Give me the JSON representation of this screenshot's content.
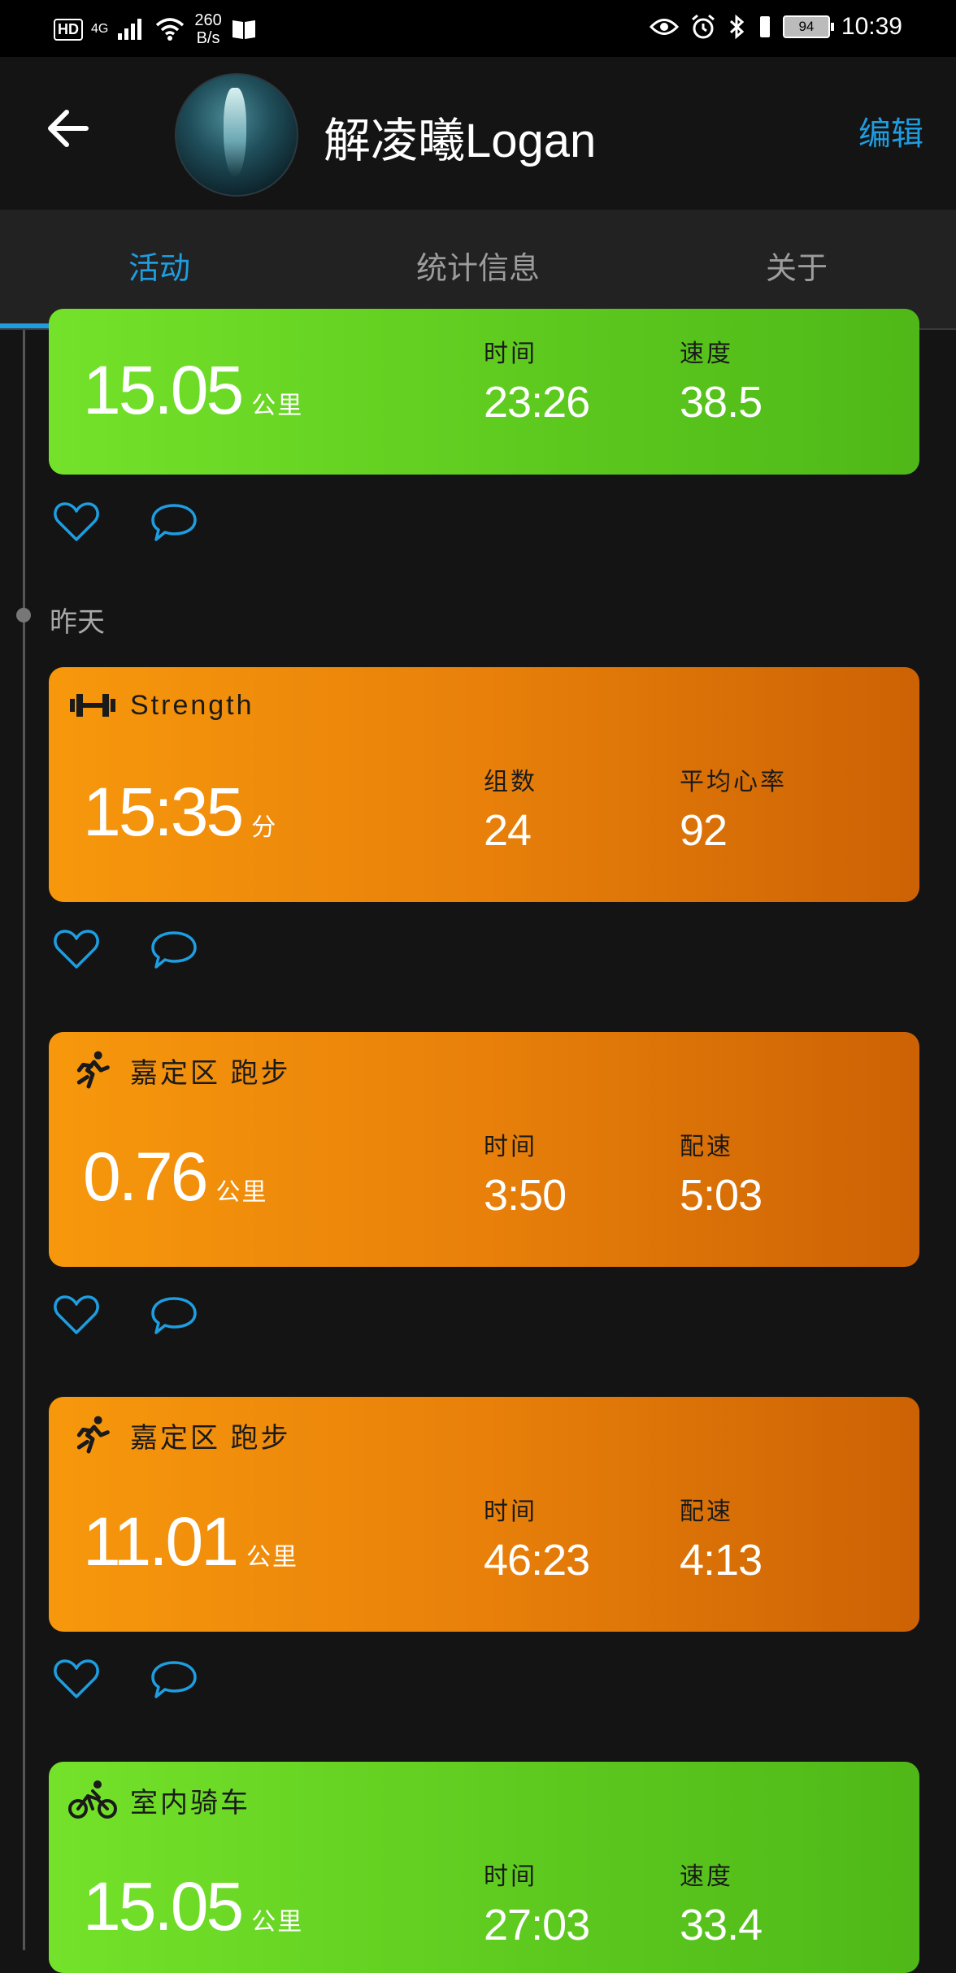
{
  "status_bar": {
    "hd": "HD",
    "network": "4G",
    "speed_value": "260",
    "speed_unit": "B/s",
    "battery": "94",
    "time": "10:39"
  },
  "header": {
    "name": "解凌曦Logan",
    "edit_label": "编辑"
  },
  "tabs": [
    {
      "label": "活动",
      "active": true
    },
    {
      "label": "统计信息",
      "active": false
    },
    {
      "label": "关于",
      "active": false
    }
  ],
  "day_label": "昨天",
  "cards": [
    {
      "color": "green",
      "title": "",
      "value": "15.05",
      "unit": "公里",
      "stat1_label": "时间",
      "stat1_value": "23:26",
      "stat2_label": "速度",
      "stat2_value": "38.5"
    },
    {
      "color": "orange",
      "title": "Strength",
      "icon": "dumbbell-icon",
      "value": "15:35",
      "unit": "分",
      "stat1_label": "组数",
      "stat1_value": "24",
      "stat2_label": "平均心率",
      "stat2_value": "92"
    },
    {
      "color": "orange",
      "title": "嘉定区 跑步",
      "icon": "running-icon",
      "value": "0.76",
      "unit": "公里",
      "stat1_label": "时间",
      "stat1_value": "3:50",
      "stat2_label": "配速",
      "stat2_value": "5:03"
    },
    {
      "color": "orange",
      "title": "嘉定区 跑步",
      "icon": "running-icon",
      "value": "11.01",
      "unit": "公里",
      "stat1_label": "时间",
      "stat1_value": "46:23",
      "stat2_label": "配速",
      "stat2_value": "4:13"
    },
    {
      "color": "green",
      "title": "室内骑车",
      "icon": "cycling-icon",
      "value": "15.05",
      "unit": "公里",
      "stat1_label": "时间",
      "stat1_value": "27:03",
      "stat2_label": "速度",
      "stat2_value": "33.4"
    }
  ],
  "colors": {
    "accent": "#1e9de0",
    "green_card": "#66d422",
    "orange_card": "#ee8a0a",
    "background": "#141414"
  }
}
